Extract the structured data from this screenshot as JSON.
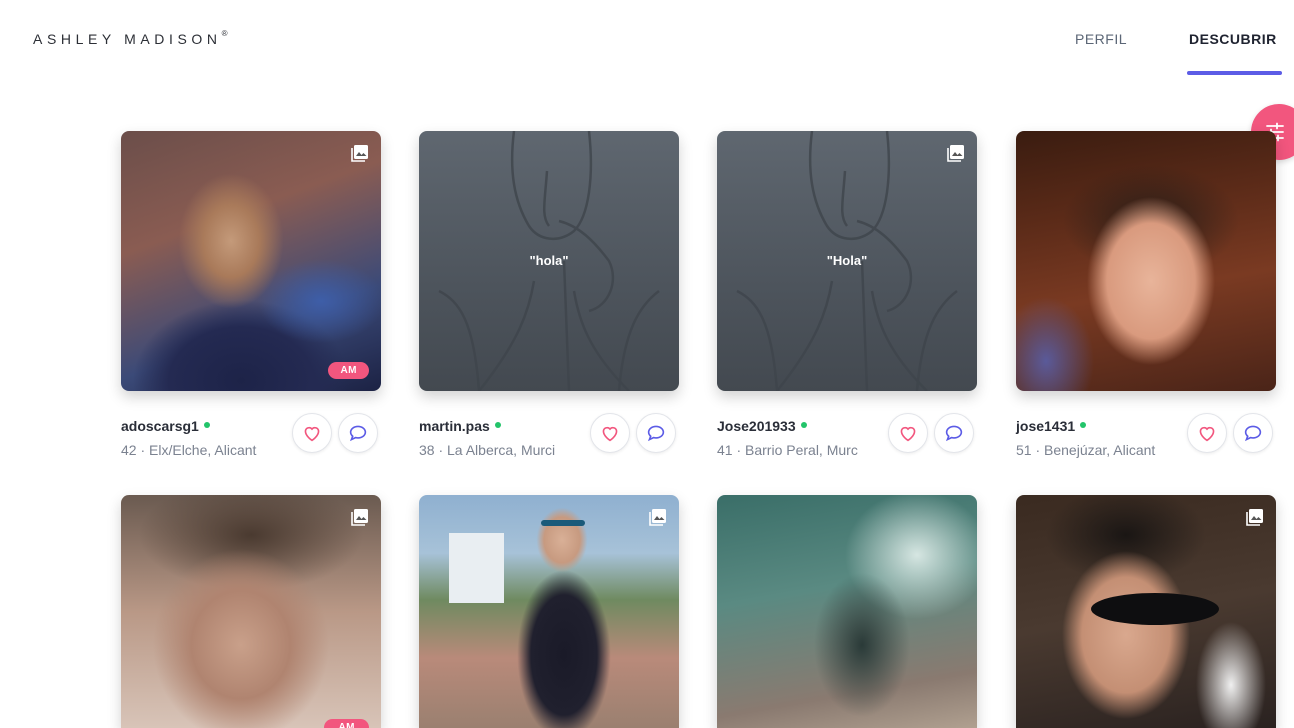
{
  "header": {
    "logo_text": "ASHLEY MADISON",
    "logo_mark": "®",
    "nav": {
      "perfil": "PERFIL",
      "descubrir": "DESCUBRIR",
      "active": "descubrir"
    }
  },
  "icons": {
    "gallery": "gallery-icon",
    "like": "heart-icon",
    "message": "chat-bubble-icon",
    "filter": "sliders-icon"
  },
  "colors": {
    "accent": "#5c5ce6",
    "pink": "#f2567e",
    "online": "#23c46a"
  },
  "profiles": [
    {
      "username": "adoscarsg1",
      "details": "42 · Elx/Elche, Alicant",
      "online": true,
      "badge": "AM",
      "quote": "",
      "gallery": true
    },
    {
      "username": "martin.pas",
      "details": "38 · La Alberca, Murci",
      "online": true,
      "badge": "",
      "quote": "\"hola\"",
      "gallery": false
    },
    {
      "username": "Jose201933",
      "details": "41 · Barrio Peral, Murc",
      "online": true,
      "badge": "",
      "quote": "\"Hola\"",
      "gallery": true
    },
    {
      "username": "jose1431",
      "details": "51 · Benejúzar, Alicant",
      "online": true,
      "badge": "",
      "quote": "",
      "gallery": false
    },
    {
      "username": "",
      "details": "",
      "online": false,
      "badge": "AM",
      "quote": "",
      "gallery": true
    },
    {
      "username": "",
      "details": "",
      "online": false,
      "badge": "",
      "quote": "",
      "gallery": true
    },
    {
      "username": "",
      "details": "",
      "online": false,
      "badge": "",
      "quote": "",
      "gallery": false
    },
    {
      "username": "",
      "details": "",
      "online": false,
      "badge": "",
      "quote": "",
      "gallery": true
    }
  ]
}
